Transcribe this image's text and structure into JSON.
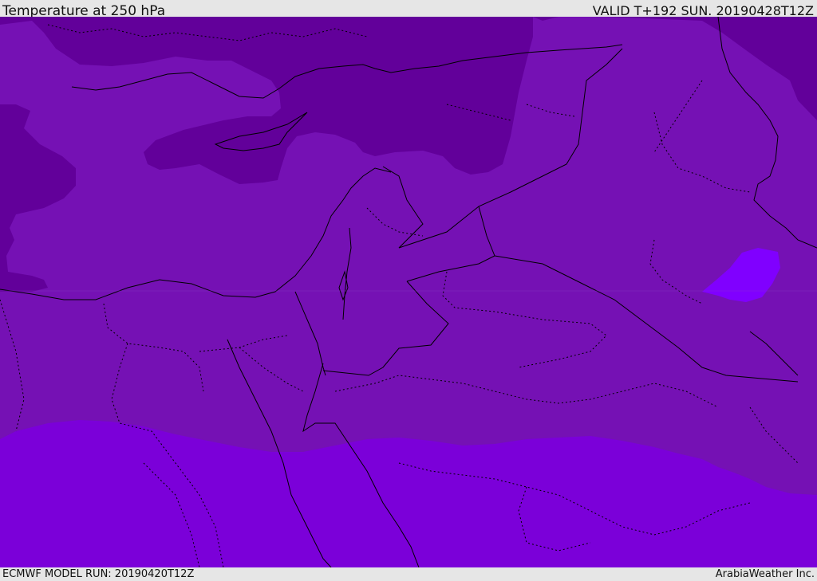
{
  "header": {
    "title": "Temperature at 250 hPa",
    "valid": "VALID T+192 SUN. 20190428T12Z"
  },
  "footer": {
    "model_run": "ECMWF MODEL RUN: 20190420T12Z",
    "credit": "ArabiaWeather Inc."
  },
  "map": {
    "colors": {
      "band_cold": "#62009a",
      "band_mid": "#7511b4",
      "band_warm": "#7b00d9",
      "band_patch": "#8000ff",
      "border": "#000000"
    }
  }
}
